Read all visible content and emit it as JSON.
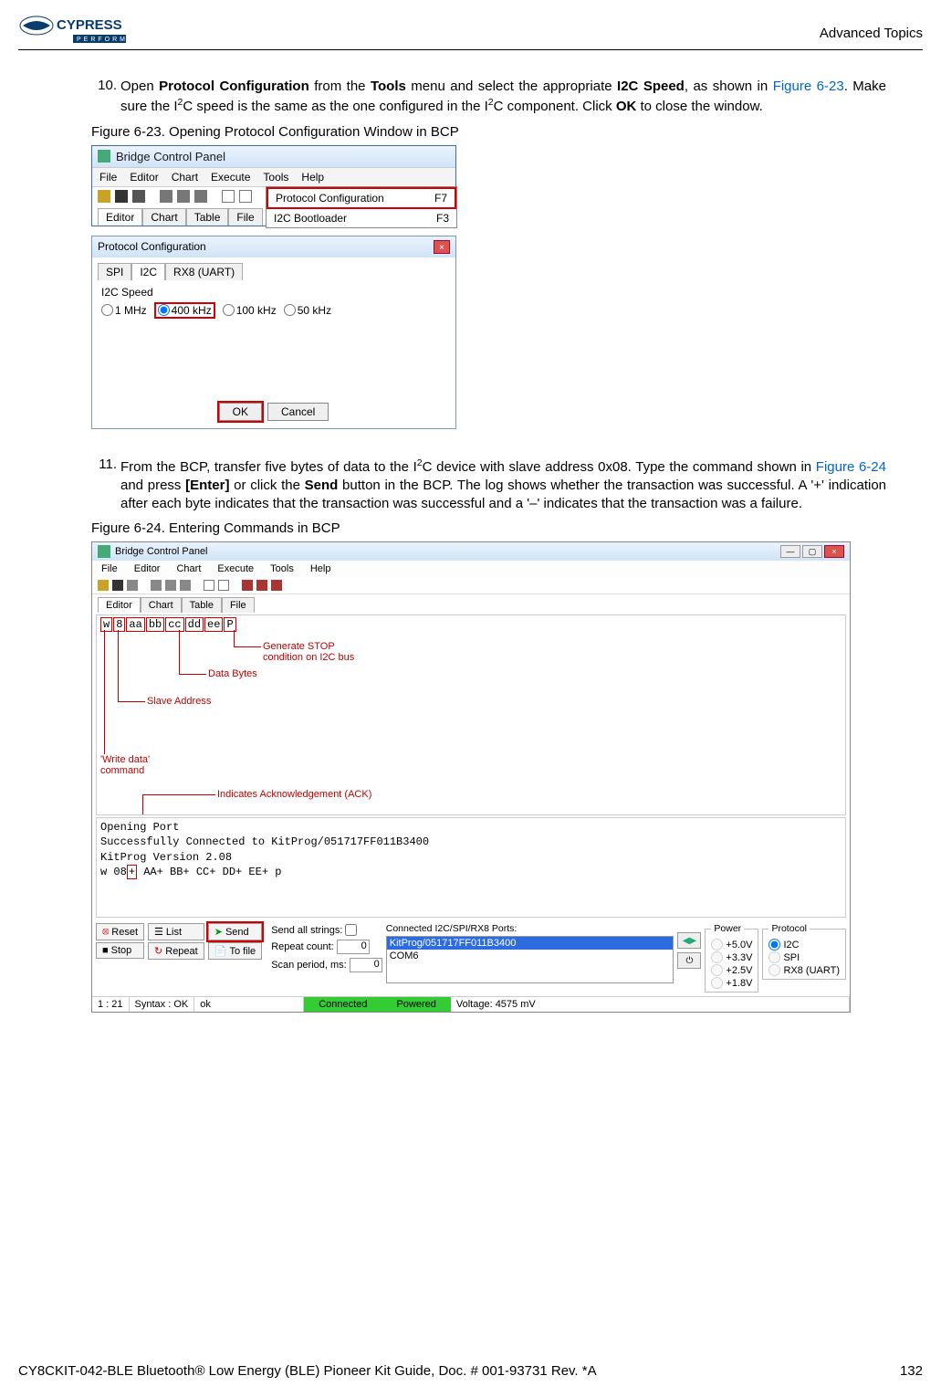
{
  "header": {
    "logo_text_top": "CYPRESS",
    "logo_text_bottom": "PERFORM",
    "section": "Advanced Topics"
  },
  "step10": {
    "num": "10.",
    "t1": "Open ",
    "b1": "Protocol Configuration",
    "t2": " from the ",
    "b2": "Tools",
    "t3": " menu and select the appropriate ",
    "b3": "I2C Speed",
    "t4": ", as shown in ",
    "link": "Figure 6-23",
    "t5": ". Make sure the I",
    "sup1": "2",
    "t6": "C speed is the same as the one configured in the I",
    "sup2": "2",
    "t7": "C component. Click ",
    "b4": "OK",
    "t8": " to close the window."
  },
  "fig623": {
    "caption": "Figure 6-23.  Opening Protocol Configuration Window in BCP",
    "bcp_title": "Bridge Control Panel",
    "menus": [
      "File",
      "Editor",
      "Chart",
      "Execute",
      "Tools",
      "Help"
    ],
    "drop": {
      "row1_label": "Protocol Configuration",
      "row1_key": "F7",
      "row2_label": "I2C Bootloader",
      "row2_key": "F3"
    },
    "tabs": [
      "Editor",
      "Chart",
      "Table",
      "File"
    ],
    "pc_title": "Protocol Configuration",
    "pc_tabs": [
      "SPI",
      "I2C",
      "RX8 (UART)"
    ],
    "speed_label": "I2C Speed",
    "speeds": [
      "1 MHz",
      "400 kHz",
      "100 kHz",
      "50 kHz"
    ],
    "ok": "OK",
    "cancel": "Cancel"
  },
  "step11": {
    "num": "11.",
    "t1": "From the BCP, transfer five bytes of data to the I",
    "sup1": "2",
    "t2": "C device with slave address 0x08. Type the command shown in ",
    "link": "Figure 6-24",
    "t3": " and press ",
    "b1": "[Enter]",
    "t4": " or click the ",
    "b2": "Send",
    "t5": " button in the BCP. The log shows whether the transaction was successful. A '+' indication after each byte indicates that the transaction was successful and a '–' indicates that the transaction was a failure."
  },
  "fig624": {
    "caption": "Figure 6-24.  Entering Commands in BCP",
    "title": "Bridge Control Panel",
    "menus": [
      "File",
      "Editor",
      "Chart",
      "Execute",
      "Tools",
      "Help"
    ],
    "tabs": [
      "Editor",
      "Chart",
      "Table",
      "File"
    ],
    "cmd": [
      "w",
      "8",
      "aa",
      "bb",
      "cc",
      "dd",
      "ee",
      "P"
    ],
    "anno_stop": "Generate STOP\ncondition on I2C bus",
    "anno_data": "Data Bytes",
    "anno_slave": "Slave Address",
    "anno_write": "'Write data'\ncommand",
    "anno_ack": "Indicates Acknowledgement (ACK)",
    "log_l1": "Opening Port",
    "log_l2": "Successfully Connected to KitProg/051717FF011B3400",
    "log_l3": "KitProg Version 2.08",
    "log_l4a": "w 08",
    "log_l4_hl": "+",
    "log_l4b": " AA+ BB+ CC+ DD+ EE+ p",
    "btn_reset": "Reset",
    "btn_list": "List",
    "btn_send": "Send",
    "btn_stop": "Stop",
    "btn_repeat": "Repeat",
    "btn_tofile": "To file",
    "send_all": "Send all strings:",
    "repeat_count": "Repeat count:",
    "repeat_val": "0",
    "scan_period": "Scan period, ms:",
    "scan_val": "0",
    "ports_label": "Connected I2C/SPI/RX8 Ports:",
    "port1": "KitProg/051717FF011B3400",
    "port2": "COM6",
    "power_legend": "Power",
    "power_opts": [
      "+5.0V",
      "+3.3V",
      "+2.5V",
      "+1.8V"
    ],
    "proto_legend": "Protocol",
    "proto_opts": [
      "I2C",
      "SPI",
      "RX8 (UART)"
    ],
    "status_pos": "1 : 21",
    "status_syntax": "Syntax : OK",
    "status_ok": "ok",
    "status_connected": "Connected",
    "status_powered": "Powered",
    "status_voltage": "Voltage: 4575 mV"
  },
  "footer": {
    "left": "CY8CKIT-042-BLE Bluetooth® Low Energy (BLE) Pioneer Kit Guide, Doc. # 001-93731 Rev. *A",
    "right": "132"
  }
}
